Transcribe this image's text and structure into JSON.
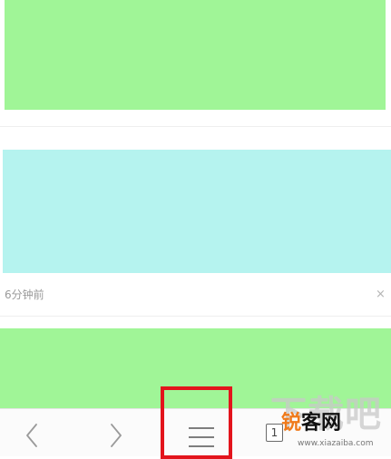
{
  "feed": {
    "items": [
      {
        "color": "#a0f597"
      },
      {
        "color": "#b5f3ef",
        "time": "6分钟前",
        "close_symbol": "×"
      },
      {
        "color": "#a0f597"
      }
    ]
  },
  "toolbar": {
    "back_icon": "chevron-left-icon",
    "forward_icon": "chevron-right-icon",
    "menu_icon": "hamburger-menu-icon",
    "tab_count": "1",
    "highlight_color": "#e3141c"
  },
  "watermark": {
    "big_text": "下载吧",
    "logo_part1": "锐",
    "logo_part2": "客网",
    "url": "www.xiazaiba.com"
  }
}
